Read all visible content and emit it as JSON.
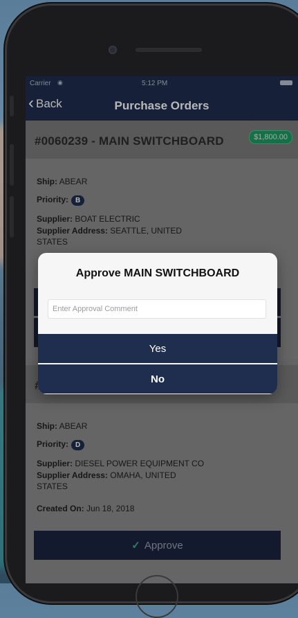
{
  "status": {
    "carrier": "Carrier",
    "time": "5:12 PM"
  },
  "nav": {
    "back_label": "Back",
    "title": "Purchase Orders"
  },
  "order1": {
    "title": "#0060239 - MAIN SWITCHBOARD",
    "amount": "$1,800.00",
    "ship_label": "Ship:",
    "ship": "ABEAR",
    "priority_label": "Priority:",
    "priority": "B",
    "supplier_label": "Supplier:",
    "supplier": "BOAT ELECTRIC",
    "address_label": "Supplier Address:",
    "address": "SEATTLE, UNITED STATES"
  },
  "order2": {
    "title_prefix": "#",
    "ship_label": "Ship:",
    "ship": "ABEAR",
    "priority_label": "Priority:",
    "priority": "D",
    "supplier_label": "Supplier:",
    "supplier": "DIESEL POWER EQUIPMENT CO",
    "address_label": "Supplier Address:",
    "address": "OMAHA, UNITED STATES",
    "created_label": "Created On:",
    "created": "Jun 18, 2018",
    "approve_label": "Approve"
  },
  "modal": {
    "title": "Approve MAIN SWITCHBOARD",
    "input_placeholder": "Enter Approval Comment",
    "yes_label": "Yes",
    "no_label": "No"
  },
  "colors": {
    "navy": "#1f2d4e",
    "green_badge": "#1e9a63"
  }
}
